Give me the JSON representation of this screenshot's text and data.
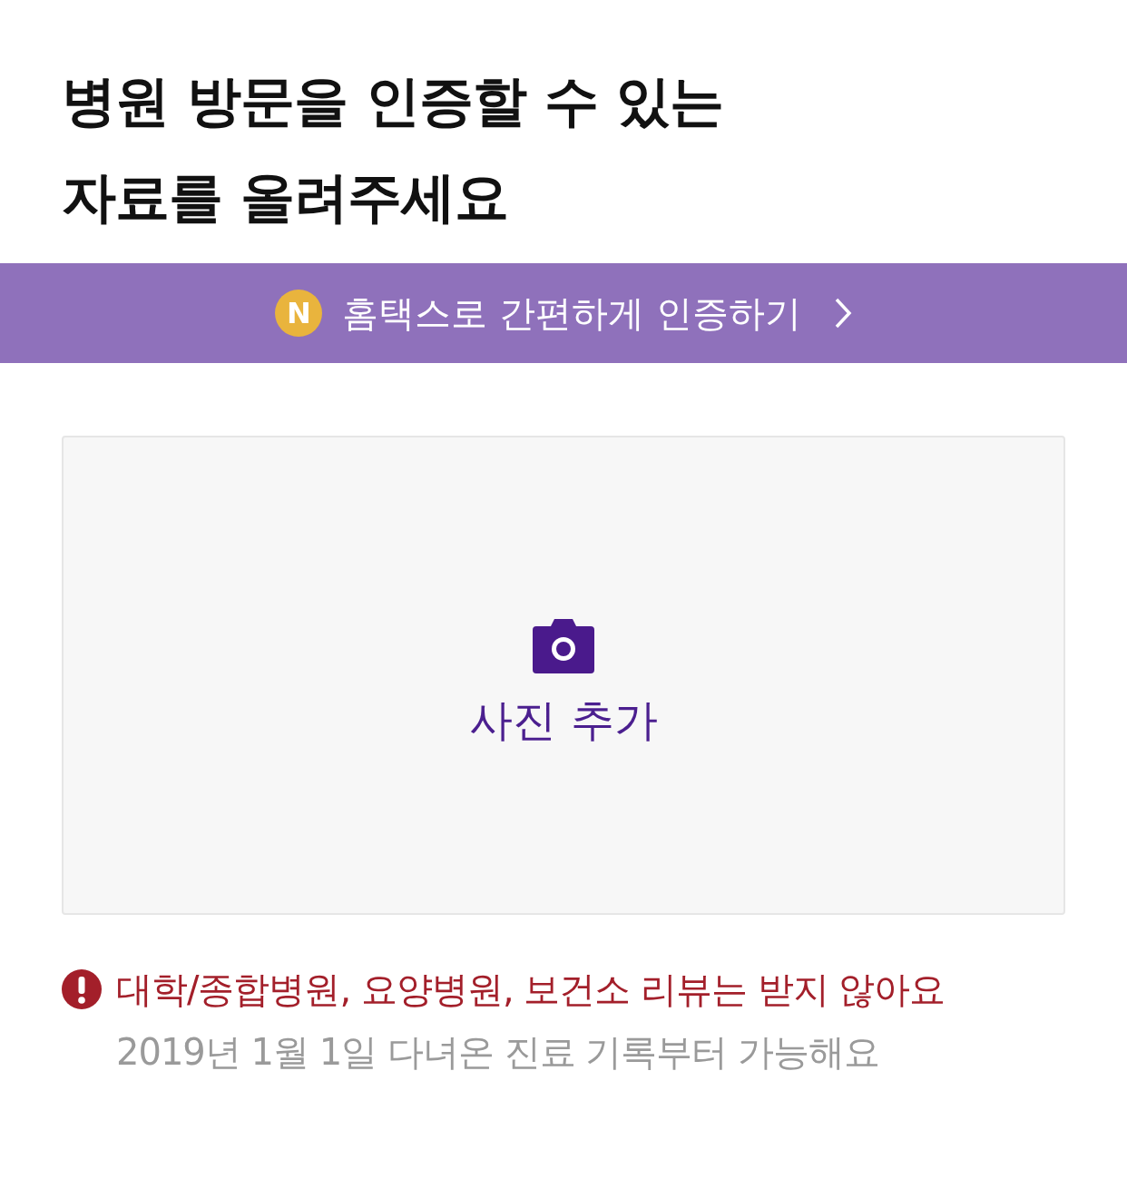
{
  "title": {
    "lines": [
      "병원 방문을 인증할 수 있는",
      "자료를 올려주세요"
    ]
  },
  "banner": {
    "badge": "N",
    "label": "홈택스로 간편하게 인증하기"
  },
  "upload": {
    "label": "사진 추가"
  },
  "notice": {
    "warning": "대학/종합병원, 요양병원, 보건소 리뷰는 받지 않아요",
    "note": "2019년 1월 1일 다녀온 진료 기록부터 가능해요"
  }
}
